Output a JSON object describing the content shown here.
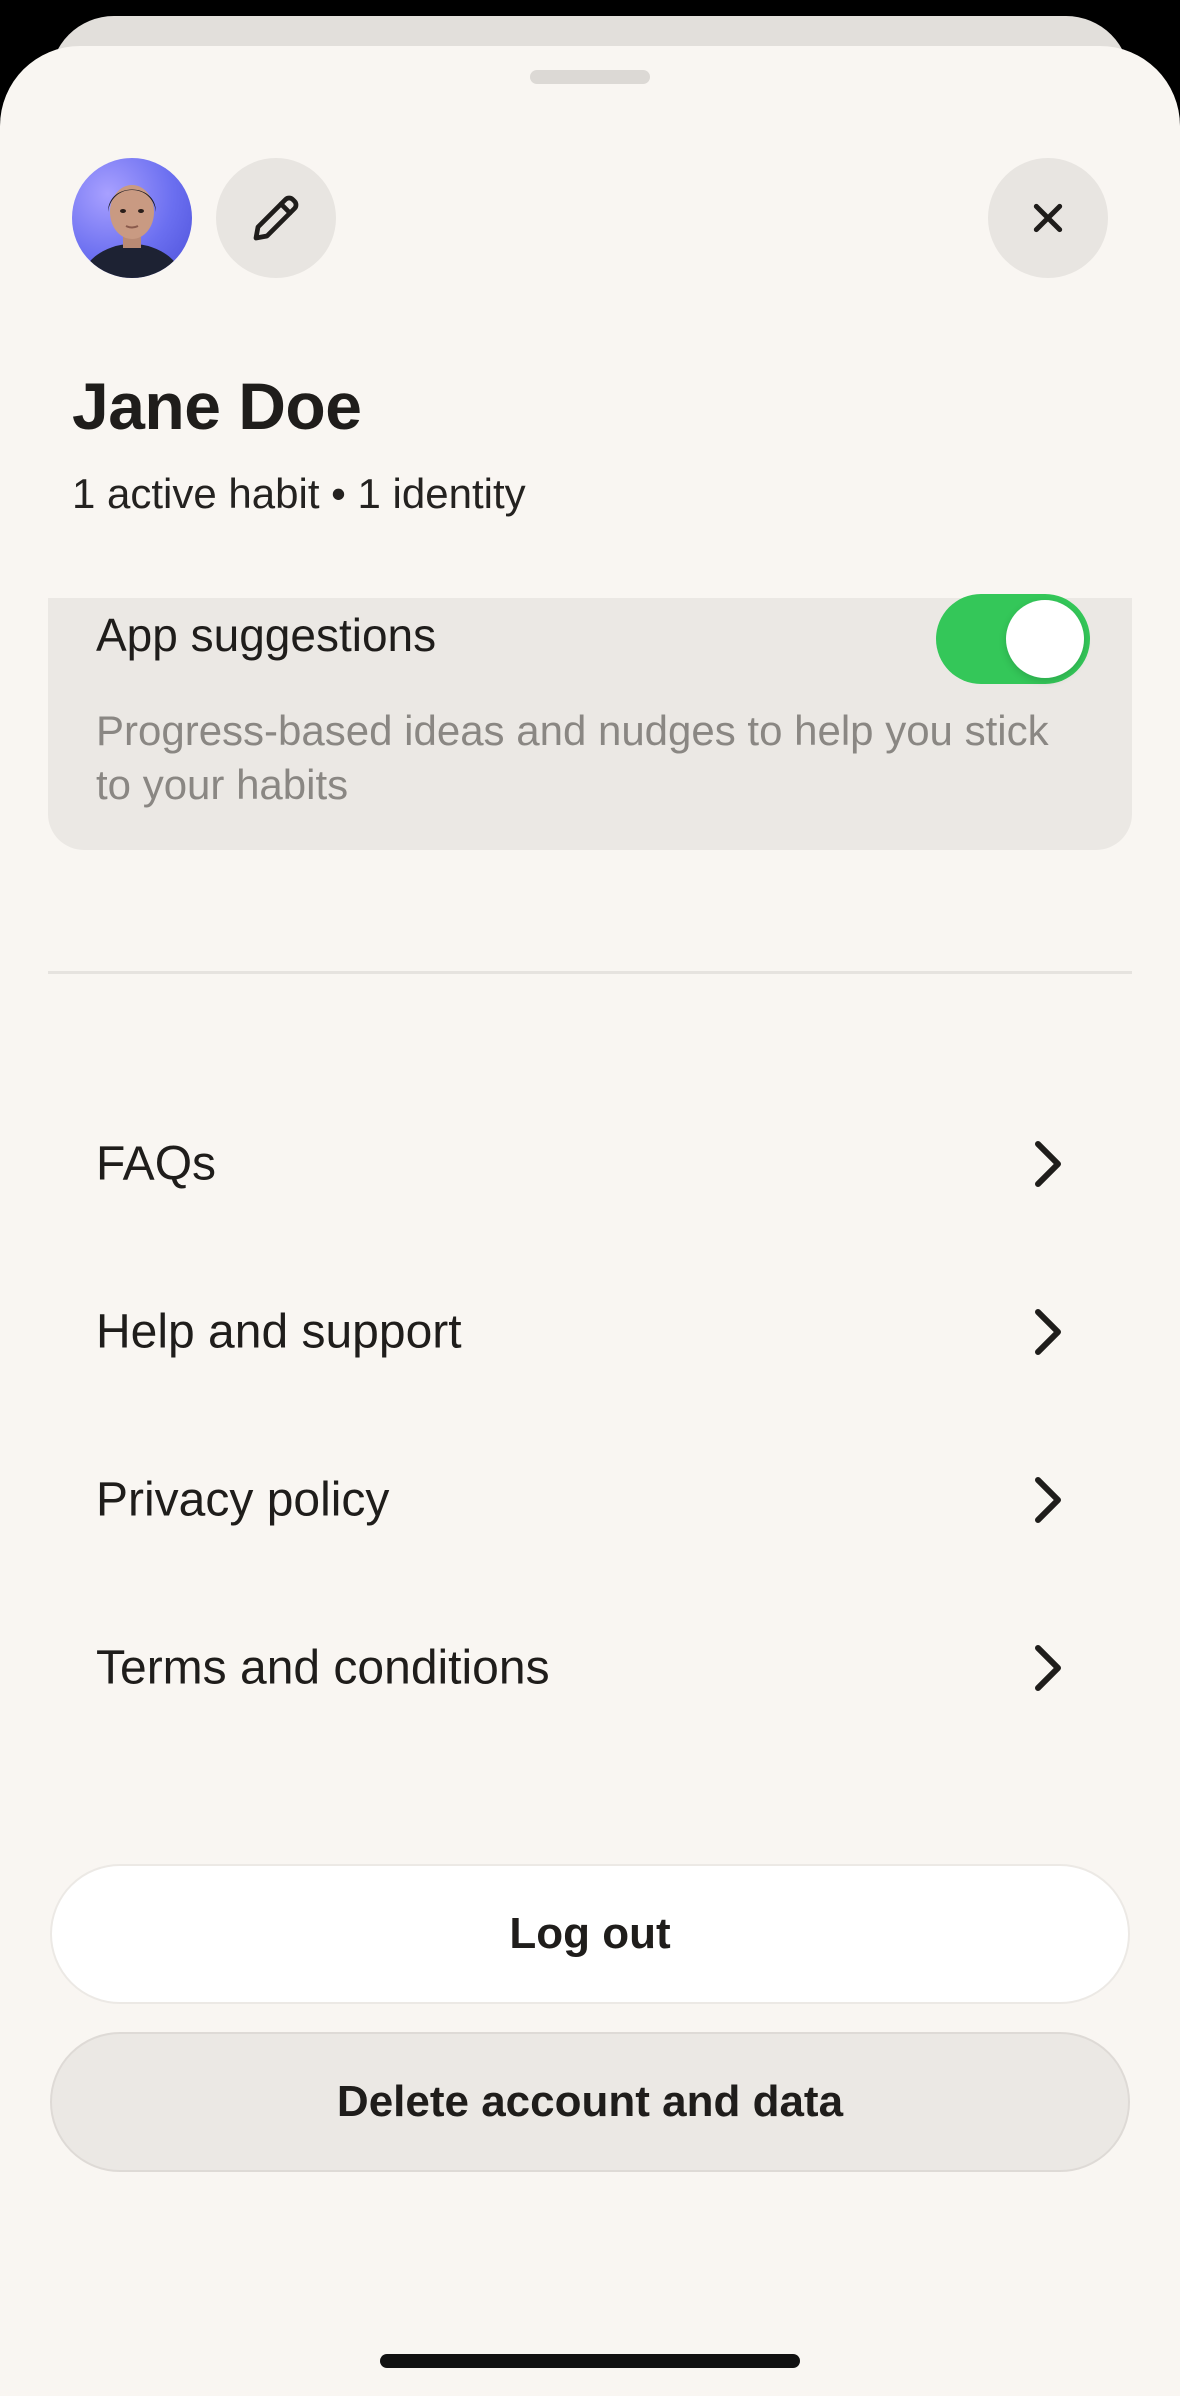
{
  "profile": {
    "name": "Jane Doe",
    "summary": "1 active habit • 1 identity"
  },
  "suggestions": {
    "title": "App suggestions",
    "description": "Progress-based ideas and nudges to help you stick to your habits",
    "enabled": true,
    "toggle_color": "#34c759"
  },
  "menu": {
    "items": [
      {
        "label": "FAQs",
        "icon": "chevron-right-icon"
      },
      {
        "label": "Help and support",
        "icon": "chevron-right-icon"
      },
      {
        "label": "Privacy policy",
        "icon": "chevron-right-icon"
      },
      {
        "label": "Terms and conditions",
        "icon": "chevron-right-icon"
      }
    ]
  },
  "actions": {
    "logout_label": "Log out",
    "delete_label": "Delete account and data"
  },
  "icons": {
    "avatar": "user-photo",
    "edit": "pencil-icon",
    "close": "close-icon"
  }
}
